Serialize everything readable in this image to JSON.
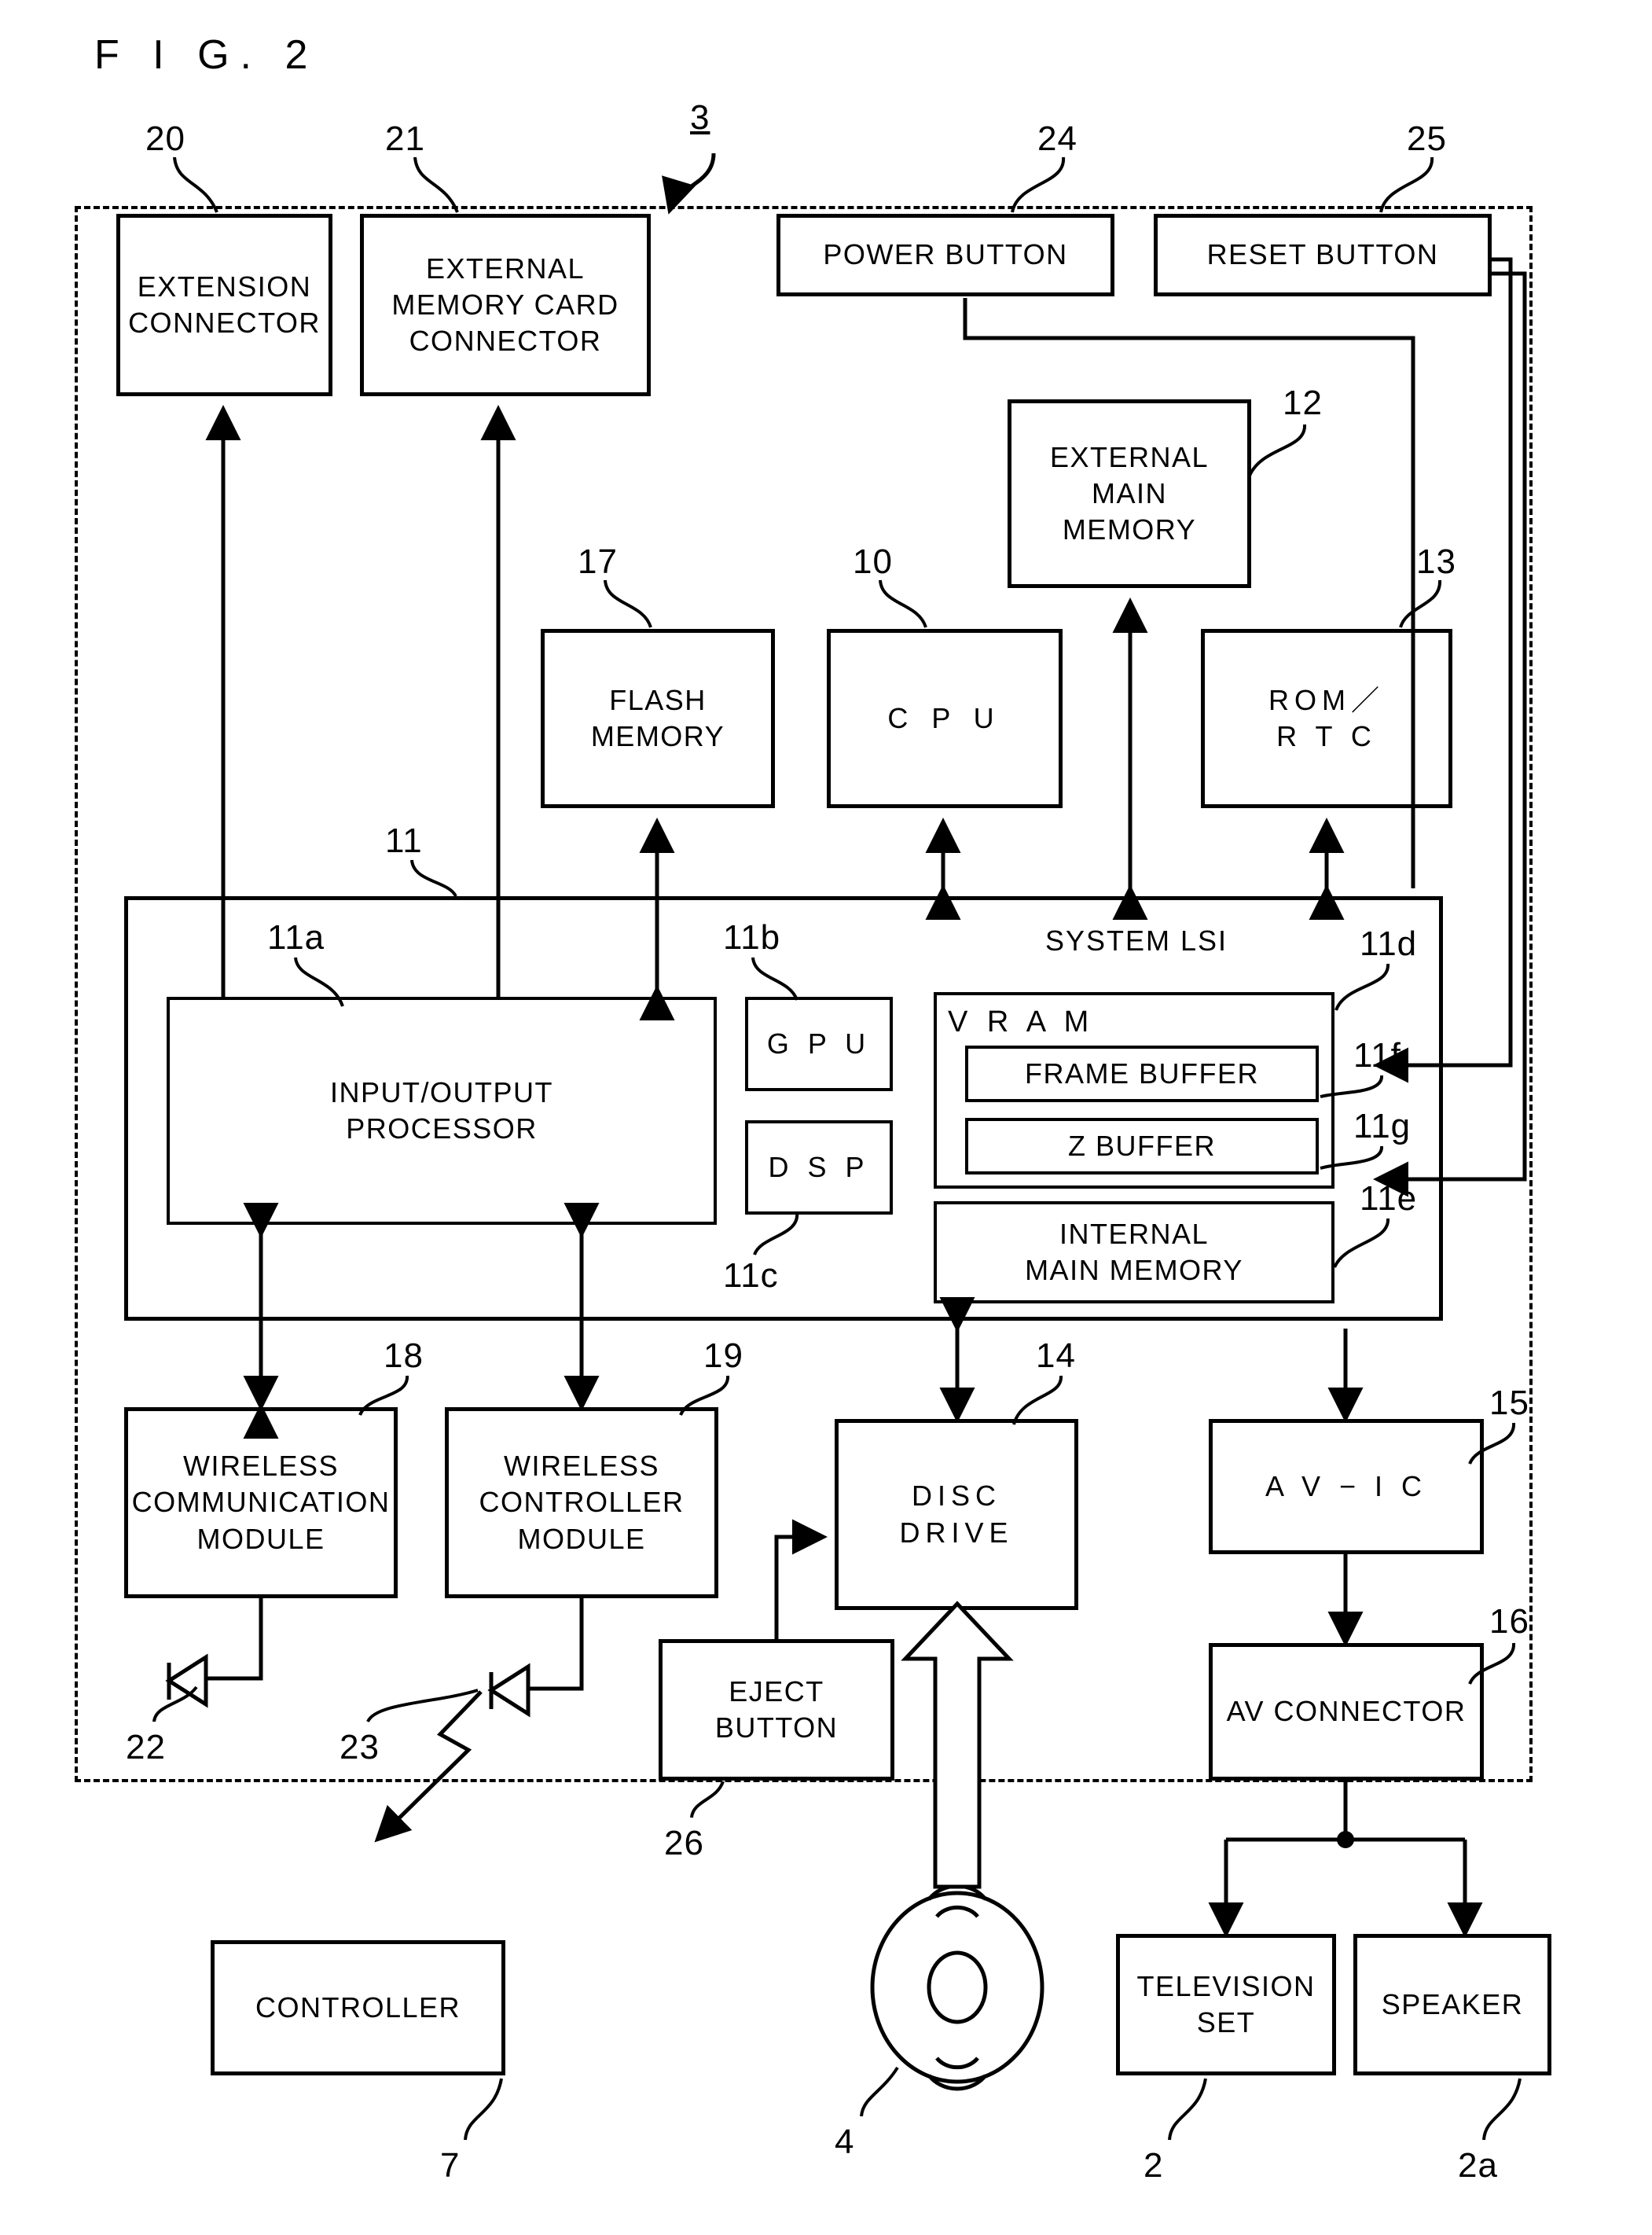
{
  "figure": {
    "title": "F I G.  2",
    "system_ref": "3"
  },
  "blocks": [
    {
      "id": "extension_connector",
      "label": "EXTENSION\nCONNECTOR",
      "ref": "20"
    },
    {
      "id": "external_memory_card",
      "label": "EXTERNAL\nMEMORY CARD\nCONNECTOR",
      "ref": "21"
    },
    {
      "id": "power_button",
      "label": "POWER BUTTON",
      "ref": "24"
    },
    {
      "id": "reset_button",
      "label": "RESET BUTTON",
      "ref": "25"
    },
    {
      "id": "external_main_memory",
      "label": "EXTERNAL\nMAIN\nMEMORY",
      "ref": "12"
    },
    {
      "id": "flash_memory",
      "label": "FLASH\nMEMORY",
      "ref": "17"
    },
    {
      "id": "cpu",
      "label": "C P U",
      "ref": "10"
    },
    {
      "id": "rom_rtc",
      "label": "ROM／\nR T C",
      "ref": "13"
    },
    {
      "id": "system_lsi",
      "label": "SYSTEM LSI",
      "ref": "11"
    },
    {
      "id": "io_processor",
      "label": "INPUT/OUTPUT\nPROCESSOR",
      "ref": "11a"
    },
    {
      "id": "gpu",
      "label": "G P U",
      "ref": "11b"
    },
    {
      "id": "dsp",
      "label": "D S P",
      "ref": "11c"
    },
    {
      "id": "vram",
      "label": "V R A M",
      "ref": "11d"
    },
    {
      "id": "frame_buffer",
      "label": "FRAME BUFFER",
      "ref": "11f"
    },
    {
      "id": "z_buffer",
      "label": "Z BUFFER",
      "ref": "11g"
    },
    {
      "id": "internal_main_memory",
      "label": "INTERNAL\nMAIN MEMORY",
      "ref": "11e"
    },
    {
      "id": "wireless_communication",
      "label": "WIRELESS\nCOMMUNICATION\nMODULE",
      "ref": "18"
    },
    {
      "id": "wireless_controller",
      "label": "WIRELESS\nCONTROLLER\nMODULE",
      "ref": "19"
    },
    {
      "id": "disc_drive",
      "label": "DISC\nDRIVE",
      "ref": "14"
    },
    {
      "id": "av_ic",
      "label": "A V − I C",
      "ref": "15"
    },
    {
      "id": "eject_button",
      "label": "EJECT\nBUTTON",
      "ref": "26"
    },
    {
      "id": "av_connector",
      "label": "AV CONNECTOR",
      "ref": "16"
    },
    {
      "id": "controller",
      "label": "CONTROLLER",
      "ref": "7"
    },
    {
      "id": "television_set",
      "label": "TELEVISION\nSET",
      "ref": "2"
    },
    {
      "id": "speaker",
      "label": "SPEAKER",
      "ref": "2a"
    }
  ],
  "antennas": [
    {
      "id": "antenna_communication",
      "ref": "22"
    },
    {
      "id": "antenna_controller",
      "ref": "23"
    }
  ],
  "optical_disc": {
    "id": "optical_disc",
    "ref": "4"
  },
  "colors": {
    "ink": "#000000",
    "paper": "#ffffff"
  }
}
